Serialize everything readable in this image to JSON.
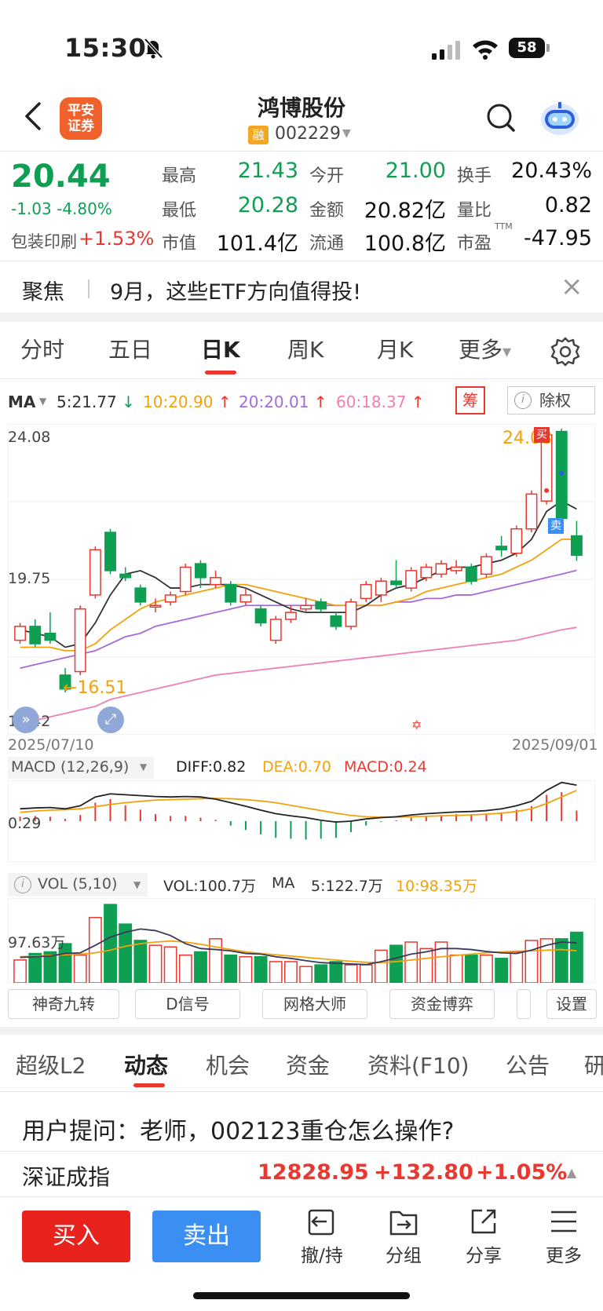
{
  "status_bar": {
    "time": "15:30",
    "battery": "58"
  },
  "header": {
    "broker_logo": "平安\n证券",
    "stock_name": "鸿博股份",
    "margin_badge": "融",
    "stock_code": "002229"
  },
  "quote": {
    "price": "20.44",
    "change": "-1.03 -4.80%",
    "sector_name": "包装印刷",
    "sector_change": "+1.53%",
    "fields": [
      {
        "label": "最高",
        "value": "21.43",
        "color": "green"
      },
      {
        "label": "今开",
        "value": "21.00",
        "color": "green"
      },
      {
        "label": "换手",
        "value": "20.43%",
        "color": "black"
      },
      {
        "label": "最低",
        "value": "20.28",
        "color": "green"
      },
      {
        "label": "金额",
        "value": "20.82亿",
        "color": "black"
      },
      {
        "label": "量比",
        "value": "0.82",
        "color": "black"
      },
      {
        "label": "市值",
        "value": "101.4亿",
        "color": "black"
      },
      {
        "label": "流通",
        "value": "100.8亿",
        "color": "black"
      },
      {
        "label": "市盈",
        "value": "-47.95",
        "color": "black",
        "superscript": "TTM"
      }
    ]
  },
  "focus": {
    "title": "聚焦",
    "text": "9月，这些ETF方向值得投!"
  },
  "period_tabs": [
    {
      "label": "分时",
      "active": false
    },
    {
      "label": "五日",
      "active": false
    },
    {
      "label": "日K",
      "active": true
    },
    {
      "label": "周K",
      "active": false
    },
    {
      "label": "月K",
      "active": false
    },
    {
      "label": "更多",
      "active": false
    }
  ],
  "ma_legend": {
    "label": "MA",
    "ma5": "5:21.77",
    "ma10": "10:20.90",
    "ma20": "20:20.01",
    "ma60": "60:18.37",
    "chou_button": "筹",
    "chuquan_button": "除权"
  },
  "colors": {
    "up": "#e8382f",
    "down": "#0e9f53",
    "ma5": "#333333",
    "ma10": "#f2a20c",
    "ma20": "#a66ad8",
    "ma60": "#f07fb6",
    "accent": "#e8382f"
  },
  "chart_data": [
    {
      "type": "candlestick",
      "axis_labels": {
        "y_top": "24.08",
        "y_mid": "19.75",
        "y_bottom": "15.42"
      },
      "x_start": "2025/07/10",
      "x_end": "2025/09/01",
      "ylim": [
        15.42,
        24.08
      ],
      "high_annotation": "24.08",
      "low_annotation": "16.51",
      "buy_marker": "买",
      "sell_marker": "卖",
      "candles": [
        {
          "o": 18.0,
          "c": 18.4,
          "h": 18.5,
          "l": 17.9
        },
        {
          "o": 18.4,
          "c": 17.9,
          "h": 18.6,
          "l": 17.8
        },
        {
          "o": 18.2,
          "c": 18.0,
          "h": 18.8,
          "l": 17.9
        },
        {
          "o": 17.0,
          "c": 16.6,
          "h": 17.2,
          "l": 16.5
        },
        {
          "o": 17.1,
          "c": 18.9,
          "h": 19.0,
          "l": 17.0
        },
        {
          "o": 19.3,
          "c": 20.6,
          "h": 20.7,
          "l": 19.2
        },
        {
          "o": 21.1,
          "c": 20.0,
          "h": 21.2,
          "l": 19.9
        },
        {
          "o": 19.9,
          "c": 19.8,
          "h": 20.1,
          "l": 19.7
        },
        {
          "o": 19.5,
          "c": 19.1,
          "h": 19.6,
          "l": 19.0
        },
        {
          "o": 19.0,
          "c": 19.0,
          "h": 19.2,
          "l": 18.8
        },
        {
          "o": 19.1,
          "c": 19.3,
          "h": 19.4,
          "l": 19.0
        },
        {
          "o": 19.4,
          "c": 20.1,
          "h": 20.2,
          "l": 19.3
        },
        {
          "o": 20.2,
          "c": 19.8,
          "h": 20.3,
          "l": 19.5
        },
        {
          "o": 19.6,
          "c": 19.8,
          "h": 20.0,
          "l": 19.5
        },
        {
          "o": 19.6,
          "c": 19.1,
          "h": 19.7,
          "l": 19.0
        },
        {
          "o": 19.1,
          "c": 19.3,
          "h": 19.5,
          "l": 19.0
        },
        {
          "o": 18.9,
          "c": 18.5,
          "h": 19.0,
          "l": 18.4
        },
        {
          "o": 18.0,
          "c": 18.6,
          "h": 18.7,
          "l": 17.9
        },
        {
          "o": 18.6,
          "c": 18.8,
          "h": 19.0,
          "l": 18.5
        },
        {
          "o": 18.9,
          "c": 19.0,
          "h": 19.2,
          "l": 18.8
        },
        {
          "o": 19.1,
          "c": 18.9,
          "h": 19.2,
          "l": 18.8
        },
        {
          "o": 18.7,
          "c": 18.4,
          "h": 18.8,
          "l": 18.3
        },
        {
          "o": 18.4,
          "c": 19.1,
          "h": 19.2,
          "l": 18.3
        },
        {
          "o": 19.2,
          "c": 19.6,
          "h": 19.7,
          "l": 19.1
        },
        {
          "o": 19.3,
          "c": 19.7,
          "h": 19.8,
          "l": 19.1
        },
        {
          "o": 19.7,
          "c": 19.6,
          "h": 20.3,
          "l": 19.5
        },
        {
          "o": 19.5,
          "c": 20.0,
          "h": 20.1,
          "l": 19.4
        },
        {
          "o": 19.8,
          "c": 20.1,
          "h": 20.2,
          "l": 19.7
        },
        {
          "o": 19.9,
          "c": 20.2,
          "h": 20.3,
          "l": 19.8
        },
        {
          "o": 20.0,
          "c": 20.1,
          "h": 20.3,
          "l": 19.9
        },
        {
          "o": 20.1,
          "c": 19.7,
          "h": 20.2,
          "l": 19.6
        },
        {
          "o": 19.9,
          "c": 20.4,
          "h": 20.5,
          "l": 19.8
        },
        {
          "o": 20.7,
          "c": 20.6,
          "h": 21.0,
          "l": 20.4
        },
        {
          "o": 20.5,
          "c": 21.2,
          "h": 21.3,
          "l": 20.4
        },
        {
          "o": 21.2,
          "c": 22.2,
          "h": 22.3,
          "l": 21.1
        },
        {
          "o": 22.0,
          "c": 23.9,
          "h": 24.08,
          "l": 21.9
        },
        {
          "o": 24.0,
          "c": 21.5,
          "h": 24.08,
          "l": 21.4
        },
        {
          "o": 21.0,
          "c": 20.44,
          "h": 21.43,
          "l": 20.28
        }
      ],
      "ma5": [
        18.3,
        18.2,
        18.1,
        17.8,
        17.9,
        18.5,
        19.3,
        19.9,
        20.0,
        19.8,
        19.5,
        19.5,
        19.6,
        19.6,
        19.6,
        19.5,
        19.3,
        19.1,
        18.9,
        18.8,
        18.8,
        18.8,
        18.8,
        19.0,
        19.3,
        19.5,
        19.6,
        19.8,
        20.0,
        20.1,
        20.1,
        20.2,
        20.3,
        20.5,
        20.9,
        21.7,
        22.0,
        21.77
      ],
      "ma10": [
        17.8,
        17.8,
        17.8,
        17.7,
        17.7,
        17.9,
        18.3,
        18.6,
        18.9,
        19.1,
        19.2,
        19.3,
        19.4,
        19.5,
        19.6,
        19.6,
        19.5,
        19.4,
        19.3,
        19.2,
        19.1,
        19.0,
        19.0,
        19.0,
        19.0,
        19.1,
        19.2,
        19.4,
        19.5,
        19.6,
        19.7,
        19.8,
        19.9,
        20.1,
        20.3,
        20.6,
        20.9,
        20.9
      ],
      "ma20": [
        17.2,
        17.3,
        17.4,
        17.5,
        17.6,
        17.7,
        17.9,
        18.1,
        18.2,
        18.4,
        18.5,
        18.6,
        18.7,
        18.8,
        18.9,
        19.0,
        19.0,
        19.0,
        19.0,
        19.0,
        19.0,
        19.0,
        19.0,
        19.0,
        19.0,
        19.1,
        19.1,
        19.2,
        19.2,
        19.3,
        19.3,
        19.4,
        19.5,
        19.6,
        19.7,
        19.8,
        19.9,
        20.01
      ],
      "ma60": [
        15.6,
        15.7,
        15.8,
        15.9,
        16.0,
        16.1,
        16.3,
        16.4,
        16.5,
        16.6,
        16.7,
        16.8,
        16.9,
        17.0,
        17.05,
        17.1,
        17.15,
        17.2,
        17.25,
        17.3,
        17.35,
        17.4,
        17.45,
        17.5,
        17.55,
        17.6,
        17.65,
        17.7,
        17.75,
        17.8,
        17.85,
        17.9,
        17.95,
        18.0,
        18.1,
        18.2,
        18.3,
        18.37
      ]
    },
    {
      "type": "macd",
      "title": "MACD (12,26,9)",
      "diff_label": "DIFF:0.82",
      "dea_label": "DEA:0.70",
      "macd_label": "MACD:0.24",
      "axis_label": "0.29",
      "diff": [
        0.28,
        0.3,
        0.31,
        0.28,
        0.35,
        0.55,
        0.62,
        0.6,
        0.58,
        0.56,
        0.55,
        0.56,
        0.55,
        0.5,
        0.42,
        0.34,
        0.25,
        0.17,
        0.12,
        0.08,
        0.02,
        -0.02,
        0.0,
        0.05,
        0.08,
        0.1,
        0.14,
        0.17,
        0.19,
        0.21,
        0.22,
        0.24,
        0.28,
        0.35,
        0.45,
        0.7,
        0.88,
        0.82
      ],
      "dea": [
        0.2,
        0.23,
        0.25,
        0.26,
        0.28,
        0.33,
        0.38,
        0.42,
        0.45,
        0.48,
        0.49,
        0.5,
        0.51,
        0.52,
        0.51,
        0.49,
        0.46,
        0.42,
        0.36,
        0.3,
        0.24,
        0.18,
        0.13,
        0.1,
        0.09,
        0.09,
        0.1,
        0.11,
        0.12,
        0.13,
        0.14,
        0.16,
        0.18,
        0.22,
        0.28,
        0.4,
        0.55,
        0.7
      ],
      "macd": [
        0.1,
        0.12,
        0.1,
        0.05,
        0.14,
        0.42,
        0.5,
        0.36,
        0.26,
        0.16,
        0.12,
        0.12,
        0.08,
        0.03,
        -0.1,
        -0.2,
        -0.3,
        -0.38,
        -0.4,
        -0.42,
        -0.4,
        -0.38,
        -0.25,
        -0.1,
        -0.02,
        0.02,
        0.08,
        0.12,
        0.14,
        0.16,
        0.16,
        0.16,
        0.2,
        0.26,
        0.34,
        0.6,
        0.66,
        0.24
      ]
    },
    {
      "type": "volume",
      "title": "VOL (5,10)",
      "vol_label": "VOL:100.7万",
      "ma_label": "MA",
      "ma5_label": "5:122.7万",
      "ma10_label": "10:98.35万",
      "axis_label": "97.63万",
      "volumes": [
        70,
        90,
        95,
        120,
        85,
        200,
        240,
        180,
        130,
        115,
        110,
        85,
        95,
        135,
        85,
        80,
        80,
        65,
        65,
        50,
        55,
        65,
        55,
        55,
        100,
        115,
        125,
        105,
        125,
        85,
        85,
        85,
        75,
        95,
        130,
        135,
        135,
        155
      ],
      "ma5": [
        78,
        80,
        82,
        90,
        92,
        115,
        140,
        155,
        165,
        160,
        145,
        120,
        105,
        102,
        98,
        90,
        88,
        80,
        75,
        68,
        62,
        60,
        58,
        56,
        65,
        76,
        88,
        95,
        105,
        105,
        102,
        96,
        92,
        90,
        100,
        115,
        125,
        122.7
      ],
      "ma10": [
        80,
        82,
        84,
        86,
        88,
        92,
        100,
        112,
        120,
        125,
        128,
        125,
        118,
        110,
        102,
        95,
        90,
        86,
        82,
        78,
        74,
        70,
        66,
        63,
        62,
        65,
        70,
        75,
        80,
        84,
        88,
        92,
        95,
        97,
        98,
        100,
        102,
        98.35
      ]
    }
  ],
  "tool_buttons": [
    "神奇九转",
    "D信号",
    "网格大师",
    "资金博弈",
    "",
    "设置"
  ],
  "bottom_tabs": [
    {
      "label": "超级L2",
      "active": false
    },
    {
      "label": "动态",
      "active": true
    },
    {
      "label": "机会",
      "active": false
    },
    {
      "label": "资金",
      "active": false
    },
    {
      "label": "资料(F10)",
      "active": false
    },
    {
      "label": "公告",
      "active": false
    },
    {
      "label": "研",
      "active": false
    }
  ],
  "question": "用户提问：老师，002123重仓怎么操作?",
  "index_ticker": {
    "name": "深证成指",
    "value": "12828.95",
    "change": "+132.80",
    "percent": "+1.05%"
  },
  "actions": {
    "buy": "买入",
    "sell": "卖出",
    "hold": "撤/持",
    "group": "分组",
    "share": "分享",
    "more": "更多"
  }
}
